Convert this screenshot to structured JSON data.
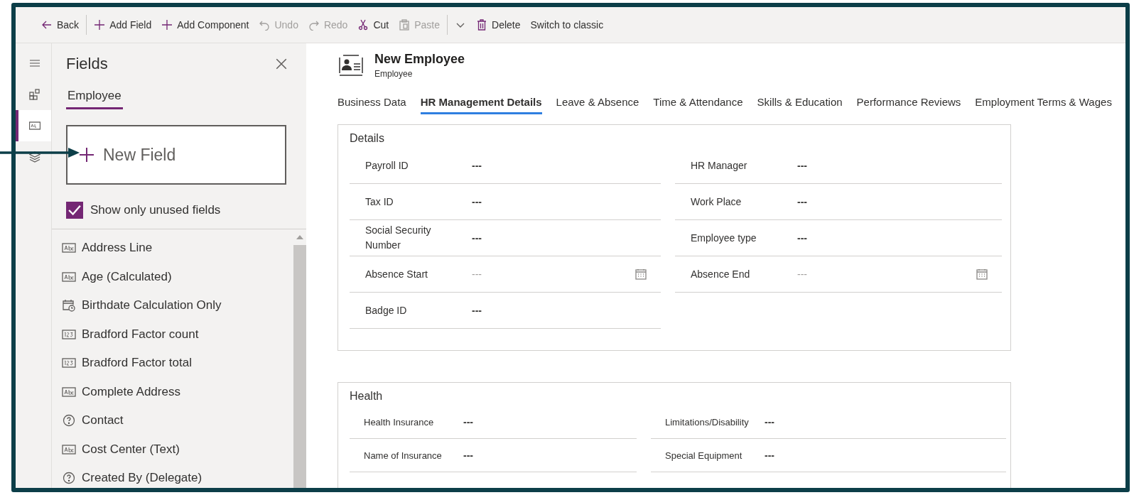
{
  "toolbar": [
    {
      "kind": "back",
      "label": "Back",
      "disabled": false
    },
    {
      "kind": "divider"
    },
    {
      "kind": "add",
      "label": "Add Field",
      "disabled": false
    },
    {
      "kind": "add",
      "label": "Add Component",
      "disabled": false
    },
    {
      "kind": "undo",
      "label": "Undo",
      "disabled": true
    },
    {
      "kind": "redo",
      "label": "Redo",
      "disabled": true
    },
    {
      "kind": "cut",
      "label": "Cut",
      "disabled": false
    },
    {
      "kind": "paste",
      "label": "Paste",
      "disabled": true
    },
    {
      "kind": "divider"
    },
    {
      "kind": "chevron"
    },
    {
      "kind": "delete",
      "label": "Delete",
      "disabled": false
    },
    {
      "kind": "plain",
      "label": "Switch to classic",
      "disabled": false
    }
  ],
  "rail": [
    {
      "kind": "menu",
      "selected": false
    },
    {
      "kind": "components",
      "selected": false
    },
    {
      "kind": "fields",
      "selected": true
    },
    {
      "kind": "layers",
      "selected": false
    }
  ],
  "fields_panel": {
    "title": "Fields",
    "tabs": [
      {
        "label": "Employee",
        "selected": true
      }
    ],
    "new_field": "New Field",
    "unused_only": {
      "label": "Show only unused fields",
      "checked": true
    },
    "items": [
      {
        "kind": "text",
        "label": "Address Line"
      },
      {
        "kind": "text",
        "label": "Age (Calculated)"
      },
      {
        "kind": "date",
        "label": "Birthdate Calculation Only"
      },
      {
        "kind": "number",
        "label": "Bradford Factor count"
      },
      {
        "kind": "number",
        "label": "Bradford Factor total"
      },
      {
        "kind": "text",
        "label": "Complete Address"
      },
      {
        "kind": "lookup",
        "label": "Contact"
      },
      {
        "kind": "text",
        "label": "Cost Center (Text)"
      },
      {
        "kind": "lookup",
        "label": "Created By (Delegate)"
      }
    ]
  },
  "form": {
    "title": "New Employee",
    "subtitle": "Employee",
    "tabs": [
      {
        "label": "Business Data",
        "selected": false
      },
      {
        "label": "HR Management Details",
        "selected": true
      },
      {
        "label": "Leave & Absence",
        "selected": false
      },
      {
        "label": "Time & Attendance",
        "selected": false
      },
      {
        "label": "Skills & Education",
        "selected": false
      },
      {
        "label": "Performance Reviews",
        "selected": false
      },
      {
        "label": "Employment Terms & Wages",
        "selected": false
      }
    ],
    "sections": [
      {
        "title": "Details",
        "columns": [
          [
            {
              "kind": "text",
              "label": "Payroll ID",
              "value": "---"
            },
            {
              "kind": "text",
              "label": "Tax ID",
              "value": "---"
            },
            {
              "kind": "text",
              "label": "Social Security Number",
              "value": "---"
            },
            {
              "kind": "date",
              "label": "Absence Start",
              "placeholder": "---"
            },
            {
              "kind": "text",
              "label": "Badge ID",
              "value": "---"
            }
          ],
          [
            {
              "kind": "text",
              "label": "HR Manager",
              "value": "---"
            },
            {
              "kind": "text",
              "label": "Work Place",
              "value": "---"
            },
            {
              "kind": "text",
              "label": "Employee type",
              "value": "---"
            },
            {
              "kind": "date",
              "label": "Absence End",
              "placeholder": "---"
            }
          ]
        ]
      },
      {
        "title": "Health",
        "columns": [
          [
            {
              "kind": "text",
              "label": "Health Insurance",
              "value": "---"
            },
            {
              "kind": "text",
              "label": "Name of Insurance",
              "value": "---"
            }
          ],
          [
            {
              "kind": "text",
              "label": "Limitations/Disability",
              "value": "---"
            },
            {
              "kind": "text",
              "label": "Special Equipment",
              "value": "---"
            }
          ]
        ]
      }
    ]
  }
}
